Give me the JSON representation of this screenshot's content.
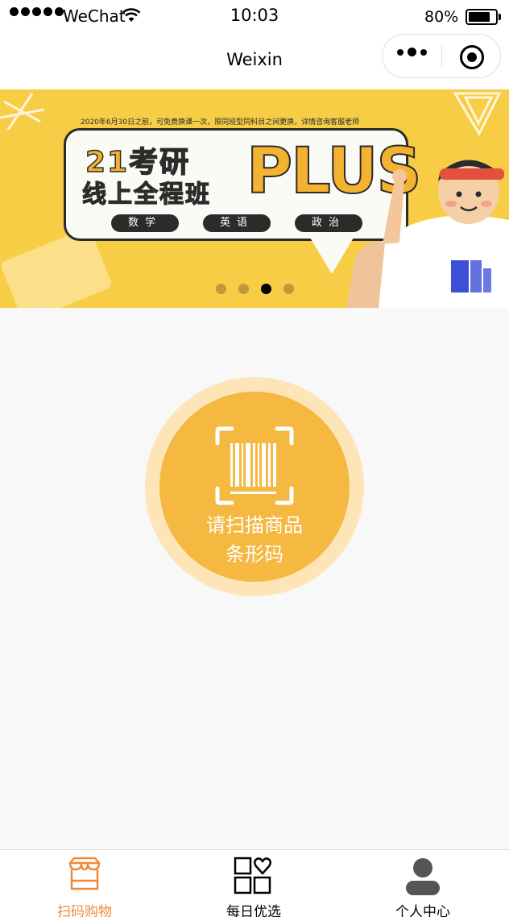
{
  "status_bar": {
    "carrier": "WeChat",
    "time": "10:03",
    "battery": "80%",
    "battery_level": 0.8
  },
  "nav": {
    "title": "Weixin"
  },
  "banner": {
    "deadline": "2020年6月30日之前，可免费换课一次，限同班型同科目之间更换，详情咨询客服老师",
    "line1": "21考研",
    "line2": "线上全程班",
    "plus": "PLUS",
    "subjects": [
      "数学",
      "英语",
      "政治"
    ],
    "slide_count": 4,
    "active_slide": 3
  },
  "scanner": {
    "line1": "请扫描商品",
    "line2": "条形码"
  },
  "tabbar": {
    "items": [
      {
        "label": "扫码购物",
        "active": true
      },
      {
        "label": "每日优选",
        "active": false
      },
      {
        "label": "个人中心",
        "active": false
      }
    ],
    "active_color": "#f08a3a"
  }
}
